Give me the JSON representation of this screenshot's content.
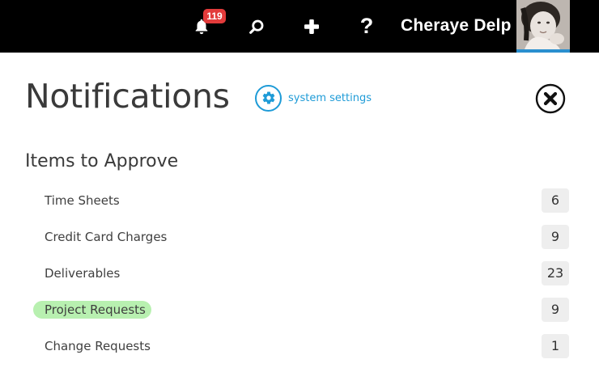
{
  "topbar": {
    "notification_count": "119",
    "help_label": "?",
    "user_name": "Cheraye Delp",
    "background": "#000000",
    "badge_color": "#e23b3b",
    "avatar_accent": "#2a8fcf"
  },
  "page": {
    "title": "Notifications",
    "system_settings_label": "system settings",
    "link_color": "#1e9bd7"
  },
  "approvals": {
    "title": "Items to Approve",
    "items": [
      {
        "label": "Time Sheets",
        "count": "6"
      },
      {
        "label": "Credit Card Charges",
        "count": "9"
      },
      {
        "label": "Deliverables",
        "count": "23"
      },
      {
        "label": "Project Requests",
        "count": "9",
        "highlighted": true
      },
      {
        "label": "Change Requests",
        "count": "1"
      }
    ],
    "highlight_color": "#b8f0b0"
  },
  "icons": {
    "bell": "bell-icon",
    "search": "search-icon",
    "add": "plus-icon",
    "help": "help-icon",
    "settings": "gear-icon",
    "close": "close-icon"
  }
}
